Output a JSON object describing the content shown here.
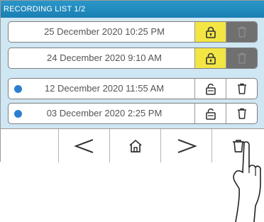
{
  "header": {
    "title": "RECORDING LIST 1/2"
  },
  "recordings": [
    {
      "label": "25 December 2020 10:25 PM",
      "locked": true,
      "unviewed": false
    },
    {
      "label": "24 December 2020 9:10 AM",
      "locked": true,
      "unviewed": false
    },
    {
      "label": "12 December 2020 11:55 AM",
      "locked": false,
      "unviewed": true
    },
    {
      "label": "03 December 2020 2:25 PM",
      "locked": false,
      "unviewed": true
    }
  ],
  "toolbar": {
    "prev_icon": "chevron-left-icon",
    "home_icon": "home-icon",
    "next_icon": "chevron-right-icon",
    "delete_icon": "trash-icon"
  },
  "colors": {
    "title_bar": "#1f88bd",
    "list_background": "#cfe6f3",
    "locked_highlight": "#f3e544",
    "disabled_delete": "#707070",
    "unviewed_dot": "#2d7fd1"
  }
}
